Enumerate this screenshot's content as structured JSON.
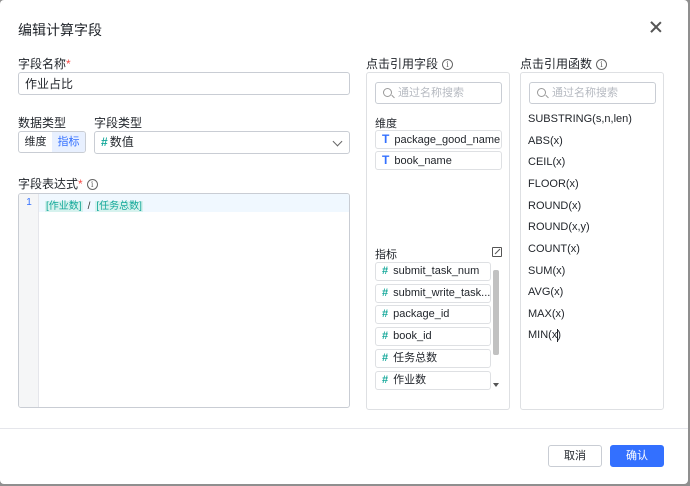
{
  "dialog": {
    "title": "编辑计算字段",
    "close_icon": "close-icon"
  },
  "left": {
    "name_label": "字段名称",
    "required_mark": "*",
    "name_value": "作业占比",
    "data_type_label": "数据类型",
    "data_type_options": [
      "维度",
      "指标"
    ],
    "data_type_selected": "指标",
    "field_type_label": "字段类型",
    "field_type_icon": "#",
    "field_type_value": "数值",
    "expr_label": "字段表达式",
    "expr_line_number": "1",
    "expr_token1": "[作业数]",
    "expr_operator": "/",
    "expr_token2": "[任务总数]"
  },
  "fields_panel": {
    "header": "点击引用字段",
    "search_placeholder": "通过名称搜索",
    "dimension_label": "维度",
    "dimension_icon": "T",
    "dimensions": [
      "package_good_name",
      "book_name"
    ],
    "metric_label": "指标",
    "metric_icon": "#",
    "metrics": [
      "submit_task_num",
      "submit_write_task...",
      "package_id",
      "book_id",
      "任务总数",
      "作业数"
    ]
  },
  "functions_panel": {
    "header": "点击引用函数",
    "search_placeholder": "通过名称搜索",
    "functions": [
      "SUBSTRING(s,n,len)",
      "ABS(x)",
      "CEIL(x)",
      "FLOOR(x)",
      "ROUND(x)",
      "ROUND(x,y)",
      "COUNT(x)",
      "SUM(x)",
      "AVG(x)",
      "MAX(x)",
      "MIN(x)"
    ]
  },
  "footer": {
    "cancel_label": "取消",
    "ok_label": "确认"
  },
  "colors": {
    "primary": "#3370ff",
    "teal": "#14a89a",
    "required": "#f54a45"
  }
}
